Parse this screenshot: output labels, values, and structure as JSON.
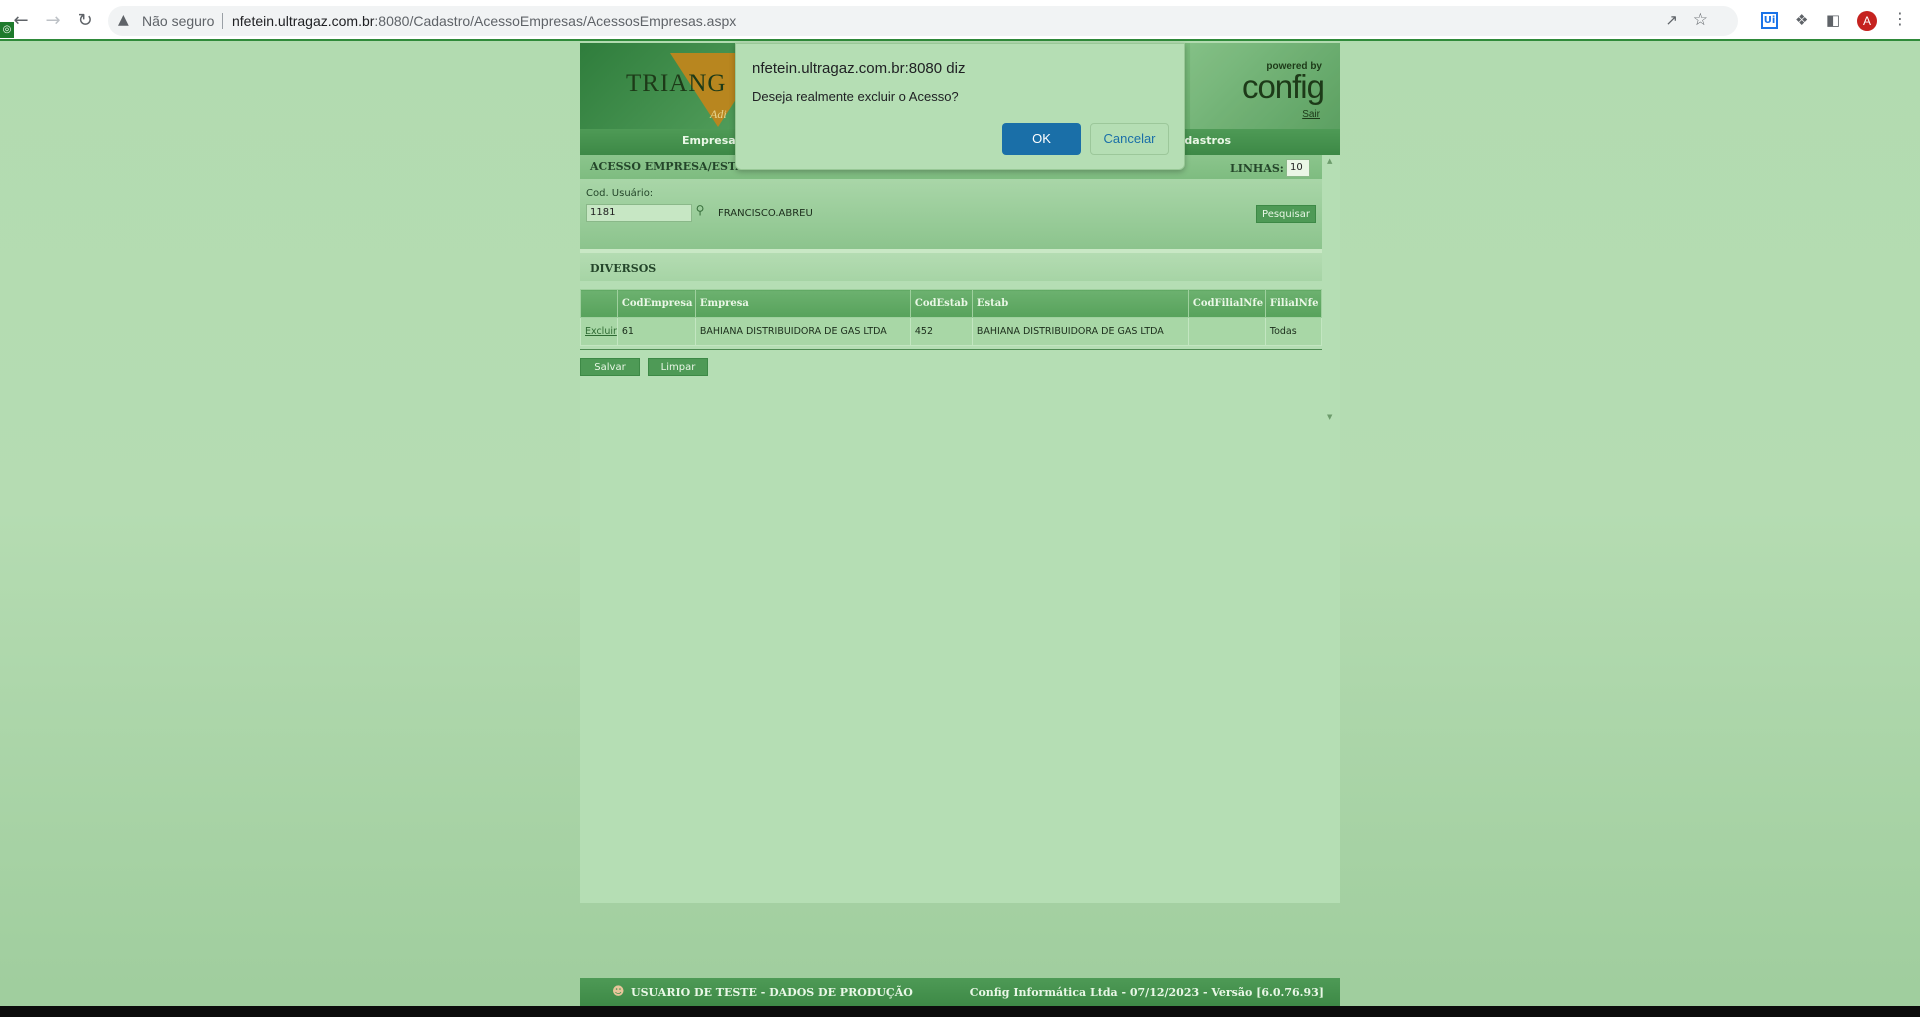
{
  "browser": {
    "insecure_label": "Não seguro",
    "url_host": "nfetein.ultragaz.com.br",
    "url_rest": ":8080/Cadastro/AcessoEmpresas/AcessosEmpresas.aspx",
    "profile_initial": "A",
    "ext_ui_label": "Ui"
  },
  "banner": {
    "logo_text": "TRIANG",
    "logo_sub": "Adi",
    "powered_by": "powered by",
    "brand": "config",
    "logout": "Sair"
  },
  "nav": {
    "items": [
      "Empresa",
      "adastros"
    ]
  },
  "panel": {
    "title": "ACESSO EMPRESA/ESTABELECIMENTO",
    "lines_label": "LINHAS:",
    "lines_value": "10"
  },
  "search": {
    "user_code_label": "Cod. Usuário:",
    "user_code_value": "1181",
    "user_name": "FRANCISCO.ABREU",
    "search_button": "Pesquisar"
  },
  "section": {
    "title": "DIVERSOS"
  },
  "grid": {
    "columns": [
      "",
      "CodEmpresa",
      "Empresa",
      "CodEstab",
      "Estab",
      "CodFilialNfe",
      "FilialNfe"
    ],
    "rows": [
      {
        "action": "Excluir",
        "cod_empresa": "61",
        "empresa": "BAHIANA DISTRIBUIDORA DE GAS LTDA",
        "cod_estab": "452",
        "estab": "BAHIANA DISTRIBUIDORA DE GAS LTDA",
        "cod_filial_nfe": "",
        "filial_nfe": "Todas"
      }
    ]
  },
  "actions": {
    "save": "Salvar",
    "clear": "Limpar"
  },
  "footer": {
    "user_text": "USUARIO DE TESTE - DADOS DE PRODUÇÃO",
    "version_text": "Config Informática Ltda - 07/12/2023 - Versão [6.0.76.93]"
  },
  "dialog": {
    "title": "nfetein.ultragaz.com.br:8080 diz",
    "message": "Deseja realmente excluir o Acesso?",
    "ok": "OK",
    "cancel": "Cancelar"
  },
  "colors": {
    "page_bg": "#b5dcb2",
    "app_green": "#4e9a56",
    "dialog_ok": "#1a6fa8"
  }
}
